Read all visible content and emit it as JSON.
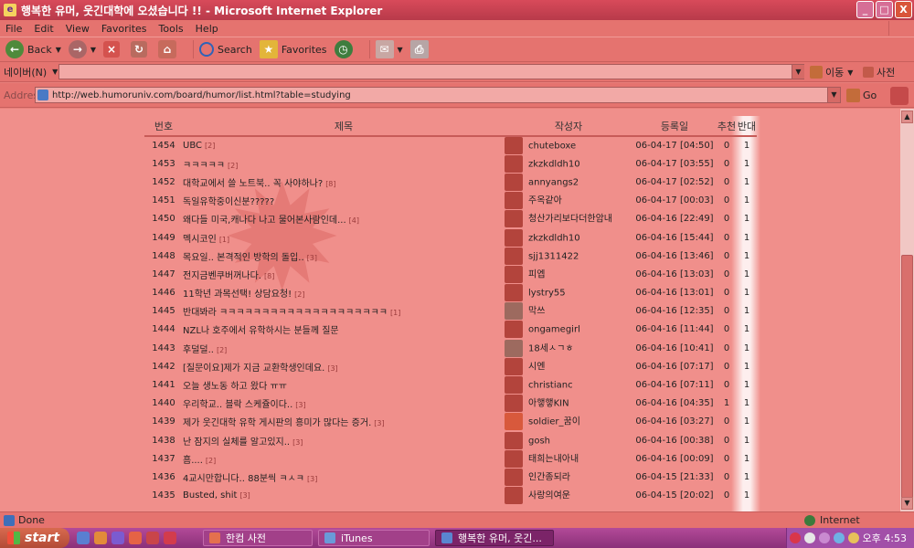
{
  "window": {
    "title": "행복한 유머, 웃긴대학에 오셨습니다 !! - Microsoft Internet Explorer",
    "min_label": "_",
    "max_label": "□",
    "close_label": "X"
  },
  "menu": [
    "File",
    "Edit",
    "View",
    "Favorites",
    "Tools",
    "Help"
  ],
  "toolbar": {
    "back": "Back",
    "search": "Search",
    "favorites": "Favorites"
  },
  "naverbar": {
    "label": "네이버(N)",
    "go": "이동",
    "dictionary": "사전"
  },
  "address": {
    "label": "Address",
    "url": "http://web.humoruniv.com/board/humor/list.html?table=studying",
    "go": "Go"
  },
  "board": {
    "headers": {
      "num": "번호",
      "subject": "제목",
      "author": "작성자",
      "date": "등록일",
      "rec": "추천",
      "opp": "반대"
    },
    "rows": [
      {
        "num": "1454",
        "subject": "UBC",
        "count": "[2]",
        "author": "chuteboxe",
        "date": "06-04-17 [04:50]",
        "rec": "0",
        "opp": "1",
        "avatar": "default"
      },
      {
        "num": "1453",
        "subject": "ㅋㅋㅋㅋㅋ",
        "count": "[2]",
        "author": "zkzkdldh10",
        "date": "06-04-17 [03:55]",
        "rec": "0",
        "opp": "1",
        "avatar": "default"
      },
      {
        "num": "1452",
        "subject": "대학교에서 쓸 노트북.. 꼭 사야하나?",
        "count": "[8]",
        "author": "annyangs2",
        "date": "06-04-17 [02:52]",
        "rec": "0",
        "opp": "1",
        "avatar": "default"
      },
      {
        "num": "1451",
        "subject": "독일유학중이신분?????",
        "count": "",
        "author": "주옥같아",
        "date": "06-04-17 [00:03]",
        "rec": "0",
        "opp": "1",
        "avatar": "default"
      },
      {
        "num": "1450",
        "subject": "왜다들 미국,캐나다 나고 물어본사람인데...",
        "count": "[4]",
        "author": "청산가리보다더한암내",
        "date": "06-04-16 [22:49]",
        "rec": "0",
        "opp": "1",
        "avatar": "default"
      },
      {
        "num": "1449",
        "subject": "멕시코인",
        "count": "[1]",
        "author": "zkzkdldh10",
        "date": "06-04-16 [15:44]",
        "rec": "0",
        "opp": "1",
        "avatar": "default"
      },
      {
        "num": "1448",
        "subject": "목요일.. 본격적인 방학의 돌입..",
        "count": "[3]",
        "author": "sjj1311422",
        "date": "06-04-16 [13:46]",
        "rec": "0",
        "opp": "1",
        "avatar": "default"
      },
      {
        "num": "1447",
        "subject": "전지금벤쿠버꺼나다.",
        "count": "[8]",
        "author": "피엡",
        "date": "06-04-16 [13:03]",
        "rec": "0",
        "opp": "1",
        "avatar": "default"
      },
      {
        "num": "1446",
        "subject": "11학년 과목선택! 상담요청!",
        "count": "[2]",
        "author": "lystry55",
        "date": "06-04-16 [13:01]",
        "rec": "0",
        "opp": "1",
        "avatar": "default"
      },
      {
        "num": "1445",
        "subject": "반대봐라 ㅋㅋㅋㅋㅋㅋㅋㅋㅋㅋㅋㅋㅋㅋㅋㅋㅋㅋㅋㅋ",
        "count": "[1]",
        "author": "막쓰",
        "date": "06-04-16 [12:35]",
        "rec": "0",
        "opp": "1",
        "avatar": "photo"
      },
      {
        "num": "1444",
        "subject": "NZL나 호주에서 유학하시는 분들께 질문",
        "count": "",
        "author": "ongamegirl",
        "date": "06-04-16 [11:44]",
        "rec": "0",
        "opp": "1",
        "avatar": "default"
      },
      {
        "num": "1443",
        "subject": "후덜덜..",
        "count": "[2]",
        "author": "18세ㅅㄱㅎ",
        "date": "06-04-16 [10:41]",
        "rec": "0",
        "opp": "1",
        "avatar": "photo"
      },
      {
        "num": "1442",
        "subject": "[질문이요]제가 지금 교환학생인데요.",
        "count": "[3]",
        "author": "시엔",
        "date": "06-04-16 [07:17]",
        "rec": "0",
        "opp": "1",
        "avatar": "default"
      },
      {
        "num": "1441",
        "subject": "오늘 생노동 하고 왔다 ㅠㅠ",
        "count": "",
        "author": "christianc",
        "date": "06-04-16 [07:11]",
        "rec": "0",
        "opp": "1",
        "avatar": "default"
      },
      {
        "num": "1440",
        "subject": "우리학교.. 블락 스케쥴이다..",
        "count": "[3]",
        "author": "아햏햏KIN",
        "date": "06-04-16 [04:35]",
        "rec": "1",
        "opp": "1",
        "avatar": "default"
      },
      {
        "num": "1439",
        "subject": "제가 웃긴대학 유학 게시판의 흥미가 많다는 증거.",
        "count": "[3]",
        "author": "soldier_꿈이",
        "date": "06-04-16 [03:27]",
        "rec": "0",
        "opp": "1",
        "avatar": "alt"
      },
      {
        "num": "1438",
        "subject": "난 잠지의 실체를 알고있지..",
        "count": "[3]",
        "author": "gosh",
        "date": "06-04-16 [00:38]",
        "rec": "0",
        "opp": "1",
        "avatar": "default"
      },
      {
        "num": "1437",
        "subject": "흠....",
        "count": "[2]",
        "author": "태희는내아내",
        "date": "06-04-16 [00:09]",
        "rec": "0",
        "opp": "1",
        "avatar": "default"
      },
      {
        "num": "1436",
        "subject": "4교시만합니다.. 88분씩 ㅋㅅㅋ",
        "count": "[3]",
        "author": "인간종되라",
        "date": "06-04-15 [21:33]",
        "rec": "0",
        "opp": "1",
        "avatar": "default"
      },
      {
        "num": "1435",
        "subject": "Busted, shit",
        "count": "[3]",
        "author": "사랑의여운",
        "date": "06-04-15 [20:02]",
        "rec": "0",
        "opp": "1",
        "avatar": "default"
      }
    ]
  },
  "status": {
    "text": "Done",
    "zone": "Internet"
  },
  "taskbar": {
    "start": "start",
    "tasks": [
      "한컴 사전",
      "iTunes",
      "행복한 유머, 웃긴..."
    ],
    "clock": "오후 4:53"
  }
}
